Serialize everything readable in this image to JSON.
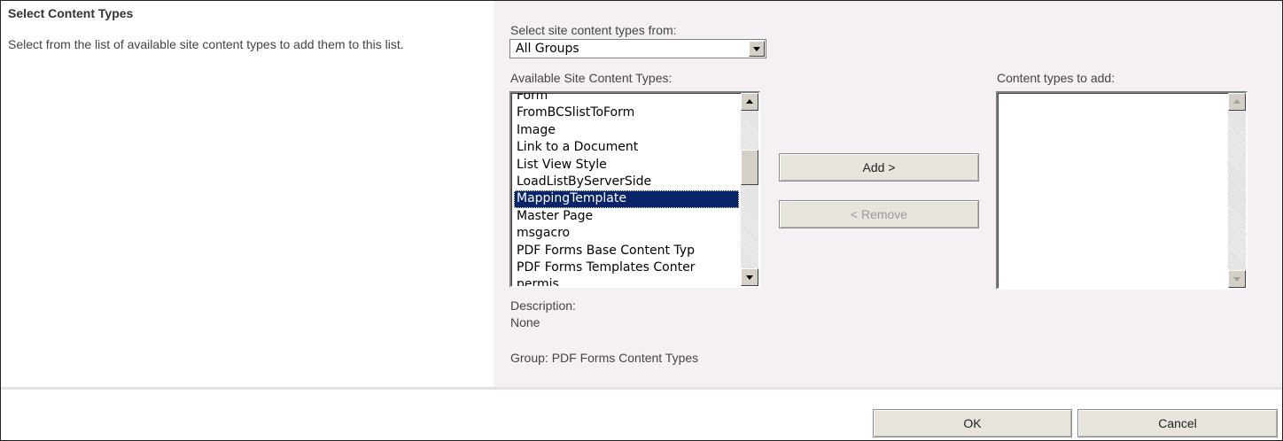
{
  "section": {
    "title": "Select Content Types",
    "description": "Select from the list of available site content types to add them to this list."
  },
  "source": {
    "label": "Select site content types from:",
    "selected_group": "All Groups"
  },
  "available": {
    "label": "Available Site Content Types:",
    "items": [
      "Form",
      "FromBCSlistToForm",
      "Image",
      "Link to a Document",
      "List View Style",
      "LoadListByServerSide",
      "MappingTemplate",
      "Master Page",
      "msgacro",
      "PDF Forms Base Content Typ",
      "PDF Forms Templates Conter",
      "permis"
    ],
    "selected_item": "MappingTemplate"
  },
  "actions": {
    "add_label": "Add >",
    "remove_label": "< Remove"
  },
  "target": {
    "label": "Content types to add:",
    "items": []
  },
  "description": {
    "label": "Description:",
    "value": "None",
    "group_text": "Group: PDF Forms Content Types"
  },
  "footer": {
    "ok_label": "OK",
    "cancel_label": "Cancel"
  },
  "colors": {
    "panel_background": "#f5f0f3",
    "selection_background": "#0a246a",
    "selection_text": "#ffffff"
  },
  "icons": {
    "dropdown": "chevron-down-icon",
    "scroll_up": "arrow-up-icon",
    "scroll_down": "arrow-down-icon"
  }
}
